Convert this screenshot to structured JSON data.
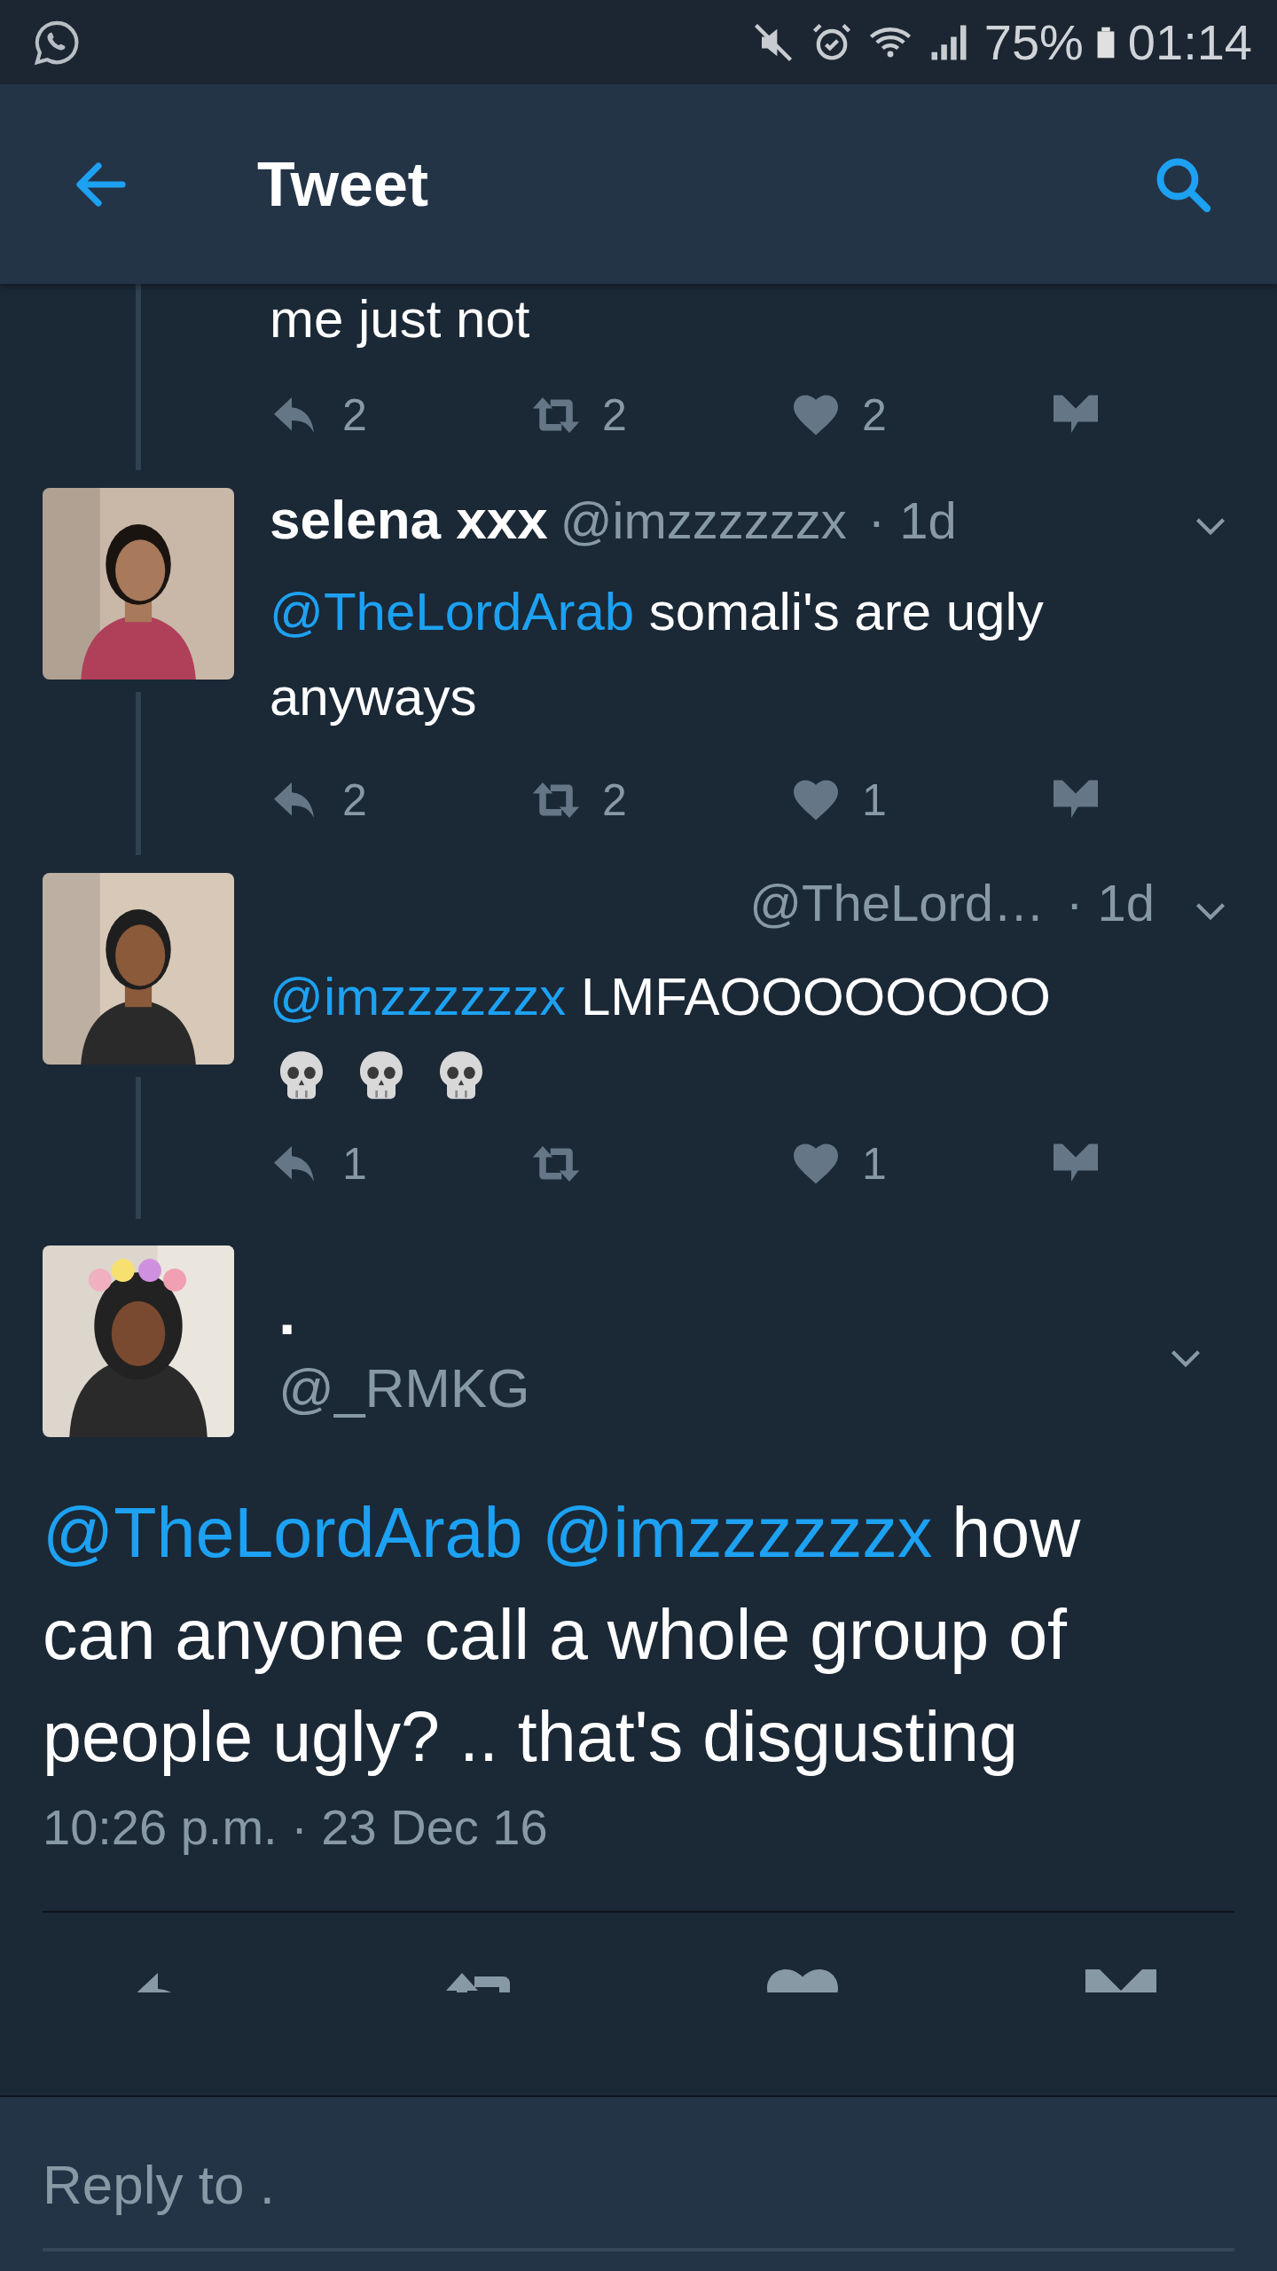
{
  "status_bar": {
    "battery": "75%",
    "time": "01:14"
  },
  "header": {
    "title": "Tweet"
  },
  "replies": [
    {
      "kind": "partial",
      "segments": [
        {
          "kind": "plain",
          "text": "me just not"
        }
      ],
      "actions": [
        {
          "kind": "reply",
          "count": "2"
        },
        {
          "kind": "retweet",
          "count": "2"
        },
        {
          "kind": "like",
          "count": "2"
        },
        {
          "kind": "message"
        }
      ]
    },
    {
      "kind": "full",
      "avatar": {
        "kind": "picture"
      },
      "name": "selena xxx",
      "handle": "@imzzzzzzx",
      "time": "· 1d",
      "segments": [
        {
          "kind": "mention",
          "text": "@TheLordArab"
        },
        {
          "kind": "plain",
          "text": "somali's are ugly anyways"
        }
      ],
      "actions": [
        {
          "kind": "reply",
          "count": "2"
        },
        {
          "kind": "retweet",
          "count": "2"
        },
        {
          "kind": "like",
          "count": "1"
        },
        {
          "kind": "message"
        }
      ]
    },
    {
      "kind": "full",
      "avatar": {
        "kind": "picture"
      },
      "handle": "@TheLord…",
      "time": "· 1d",
      "segments": [
        {
          "kind": "mention",
          "text": "@imzzzzzzx"
        },
        {
          "kind": "plain",
          "text": "LMFAOOOOOOOO"
        }
      ],
      "emojis": [
        {
          "kind": "skull"
        },
        {
          "kind": "skull"
        },
        {
          "kind": "skull"
        }
      ],
      "actions": [
        {
          "kind": "reply",
          "count": "1"
        },
        {
          "kind": "retweet"
        },
        {
          "kind": "like",
          "count": "1"
        },
        {
          "kind": "message"
        }
      ]
    }
  ],
  "main_tweet": {
    "avatar": {
      "kind": "picture"
    },
    "name": ".",
    "handle": "@_RMKG",
    "segments": [
      {
        "kind": "mention",
        "text": "@TheLordArab"
      },
      {
        "kind": "mention",
        "text": "@imzzzzzzx"
      },
      {
        "kind": "plain",
        "text": "how can anyone call a whole group of people ugly? .. that's disgusting"
      }
    ],
    "timestamp": "10:26 p.m. · 23 Dec 16",
    "actions": [
      {
        "kind": "reply"
      },
      {
        "kind": "retweet"
      },
      {
        "kind": "like"
      },
      {
        "kind": "message"
      }
    ]
  },
  "reply_bar": {
    "placeholder": "Reply to ."
  }
}
